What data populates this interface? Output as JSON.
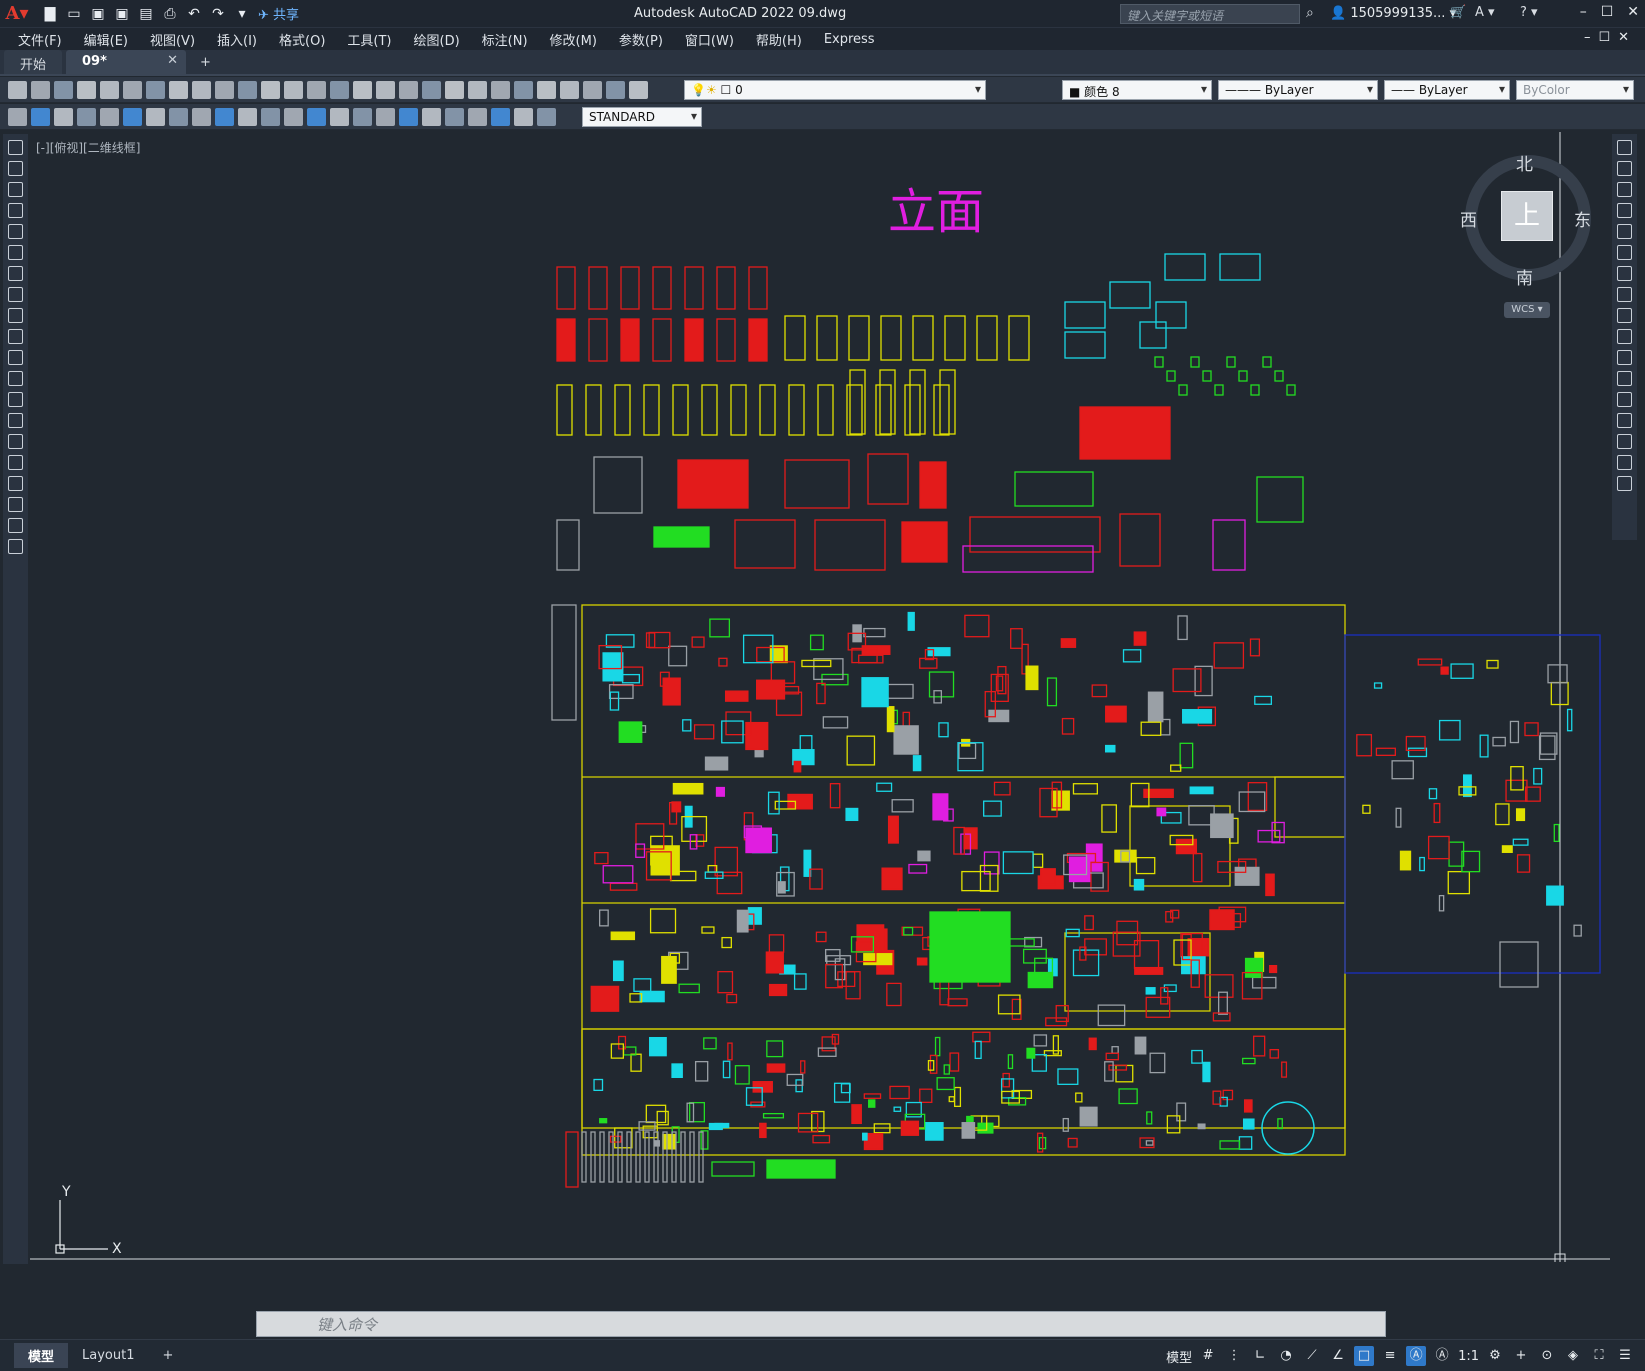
{
  "titlebar": {
    "app_title": "Autodesk AutoCAD 2022    09.dwg",
    "share_label": "共享",
    "search_placeholder": "键入关键字或短语",
    "user_label": "1505999135...",
    "quick_access_icons": [
      "new-icon",
      "open-icon",
      "save-icon",
      "save-as-icon",
      "plot-icon",
      "undo-icon",
      "redo-icon"
    ]
  },
  "menu": {
    "items": [
      "文件(F)",
      "编辑(E)",
      "视图(V)",
      "插入(I)",
      "格式(O)",
      "工具(T)",
      "绘图(D)",
      "标注(N)",
      "修改(M)",
      "参数(P)",
      "窗口(W)",
      "帮助(H)",
      "Express"
    ]
  },
  "tabs": {
    "items": [
      "开始",
      "09*"
    ],
    "active_index": 1
  },
  "toolbar": {
    "layer_value": "0",
    "color_value": "颜色 8",
    "linetype_value": "ByLayer",
    "lineweight_value": "ByLayer",
    "plotstyle_value": "ByColor",
    "textstyle_value": "STANDARD"
  },
  "viewport": {
    "label": "[-][俯视][二维线框]",
    "drawing_title": "立面",
    "viewcube_face": "上",
    "compass": {
      "north": "北",
      "south": "南",
      "east": "东",
      "west": "西"
    },
    "wcs_label": "WCS",
    "ucs_y": "Y",
    "ucs_x": "X"
  },
  "command": {
    "placeholder": "键入命令"
  },
  "status": {
    "layouts": [
      "模型",
      "Layout1"
    ],
    "active_layout": 0,
    "model_label": "模型",
    "scale_label": "1:1"
  },
  "colors": {
    "bg": "#212830",
    "red": "#e31b1b",
    "yellow": "#e0e000",
    "cyan": "#19d7e6",
    "green": "#22dd22",
    "magenta": "#e01ee0",
    "grey": "#9aa0a6",
    "frame": "#d6d100",
    "blue_frame": "#1a2ec0"
  }
}
